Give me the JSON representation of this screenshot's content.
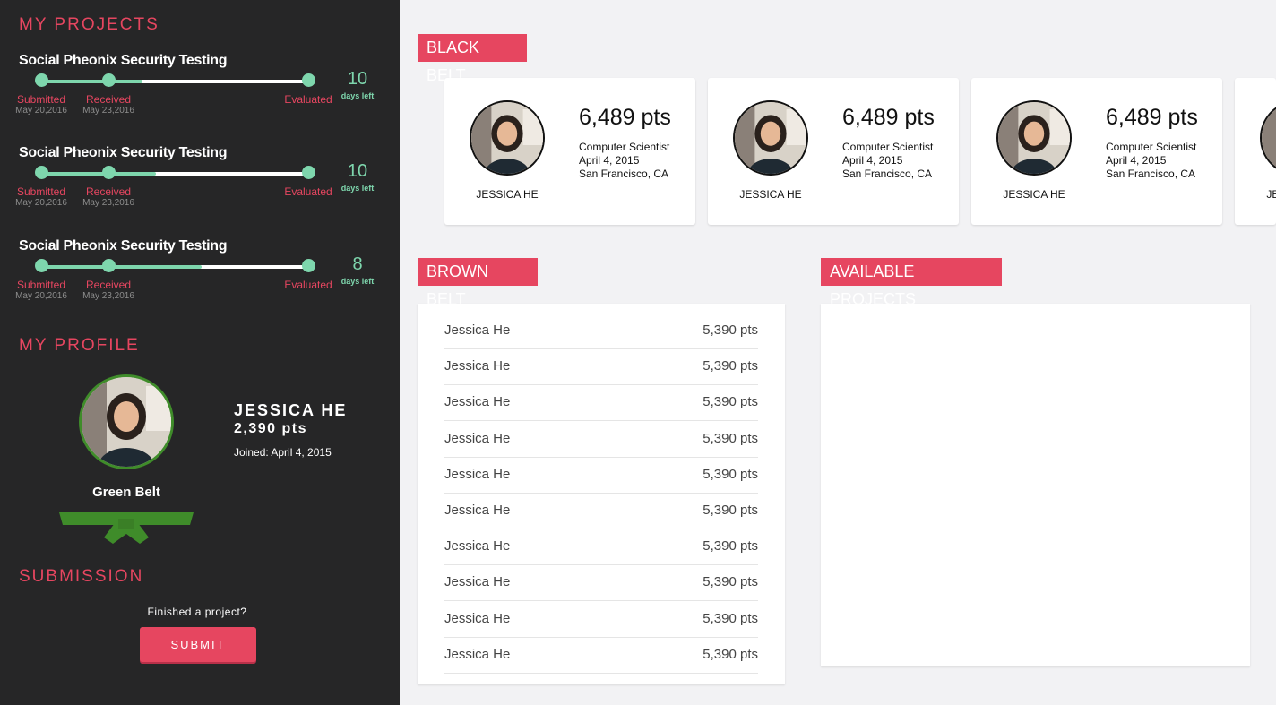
{
  "sidebar": {
    "my_projects_title": "MY PROJECTS",
    "projects": [
      {
        "title": "Social Pheonix Security Testing",
        "progress": 0.38,
        "stages": [
          {
            "label": "Submitted",
            "date": "May 20,2016"
          },
          {
            "label": "Received",
            "date": "May 23,2016"
          },
          {
            "label": "Evaluated",
            "date": ""
          }
        ],
        "days_left": "10",
        "days_label": "days left"
      },
      {
        "title": "Social Pheonix Security Testing",
        "progress": 0.43,
        "stages": [
          {
            "label": "Submitted",
            "date": "May 20,2016"
          },
          {
            "label": "Received",
            "date": "May 23,2016"
          },
          {
            "label": "Evaluated",
            "date": ""
          }
        ],
        "days_left": "10",
        "days_label": "days left"
      },
      {
        "title": "Social Pheonix Security Testing",
        "progress": 0.6,
        "stages": [
          {
            "label": "Submitted",
            "date": "May 20,2016"
          },
          {
            "label": "Received",
            "date": "May 23,2016"
          },
          {
            "label": "Evaluated",
            "date": ""
          }
        ],
        "days_left": "8",
        "days_label": "days left"
      }
    ],
    "my_profile_title": "MY PROFILE",
    "profile": {
      "name": "JESSICA HE",
      "points": "2,390 pts",
      "joined": "Joined: April 4, 2015",
      "belt": "Green Belt",
      "belt_color": "#3f8c2a"
    },
    "submission_title": "SUBMISSION",
    "submission_question": "Finished a project?",
    "submit_label": "SUBMIT"
  },
  "black_belt": {
    "title": "BLACK BELT",
    "cards": [
      {
        "name": "JESSICA HE",
        "points": "6,489 pts",
        "role": "Computer Scientist",
        "date": "April 4, 2015",
        "location": "San Francisco, CA"
      },
      {
        "name": "JESSICA HE",
        "points": "6,489 pts",
        "role": "Computer Scientist",
        "date": "April 4, 2015",
        "location": "San Francisco, CA"
      },
      {
        "name": "JESSICA HE",
        "points": "6,489 pts",
        "role": "Computer Scientist",
        "date": "April 4, 2015",
        "location": "San Francisco, CA"
      },
      {
        "name": "JESSICA HE",
        "points": "",
        "role": "",
        "date": "",
        "location": ""
      }
    ]
  },
  "brown_belt": {
    "title": "BROWN BELT",
    "rows": [
      {
        "name": "Jessica He",
        "points": "5,390 pts"
      },
      {
        "name": "Jessica He",
        "points": "5,390 pts"
      },
      {
        "name": "Jessica He",
        "points": "5,390 pts"
      },
      {
        "name": "Jessica He",
        "points": "5,390 pts"
      },
      {
        "name": "Jessica He",
        "points": "5,390 pts"
      },
      {
        "name": "Jessica He",
        "points": "5,390 pts"
      },
      {
        "name": "Jessica He",
        "points": "5,390 pts"
      },
      {
        "name": "Jessica He",
        "points": "5,390 pts"
      },
      {
        "name": "Jessica He",
        "points": "5,390 pts"
      },
      {
        "name": "Jessica He",
        "points": "5,390 pts"
      }
    ]
  },
  "available_projects": {
    "title": "AVAILABLE PROJECTS"
  },
  "colors": {
    "accent": "#e64660",
    "progress": "#7ed6ad",
    "sidebar_bg": "#262627"
  }
}
